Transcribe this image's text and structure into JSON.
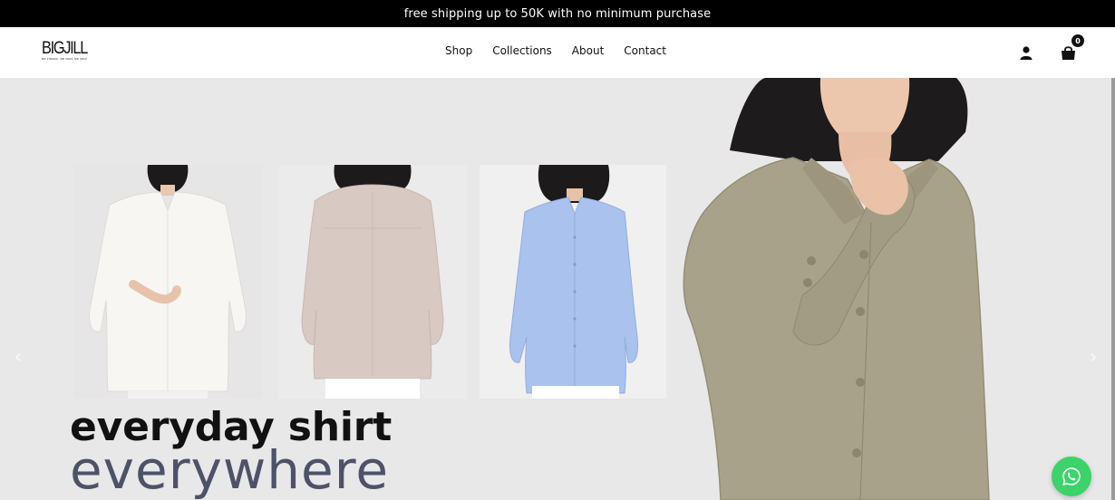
{
  "promo": {
    "text": "free shipping up to 50K with no minimum purchase"
  },
  "header": {
    "logo_text": "BIGJILL",
    "logo_tagline": "be classic. be cool. be you!",
    "nav": [
      {
        "label": "Shop"
      },
      {
        "label": "Collections"
      },
      {
        "label": "About"
      },
      {
        "label": "Contact"
      }
    ],
    "cart_count": "0",
    "icons": [
      "account-icon",
      "shopping-bag-icon"
    ]
  },
  "hero": {
    "headline_line1": "everyday shirt",
    "headline_line2": "everywhere",
    "products": [
      {
        "shirt_color": "#f7f6f3",
        "name": "white-shirt"
      },
      {
        "shirt_color": "#d8c9c2",
        "name": "blush-shirt"
      },
      {
        "shirt_color": "#a9c2ee",
        "name": "blue-shirt"
      }
    ],
    "model_shirt_color": "#a9a28b",
    "background_color": "#e8e8e9",
    "arrows": {
      "prev": "‹",
      "next": "›"
    }
  },
  "chat": {
    "icon": "whatsapp-icon",
    "color": "#3bd36a"
  }
}
